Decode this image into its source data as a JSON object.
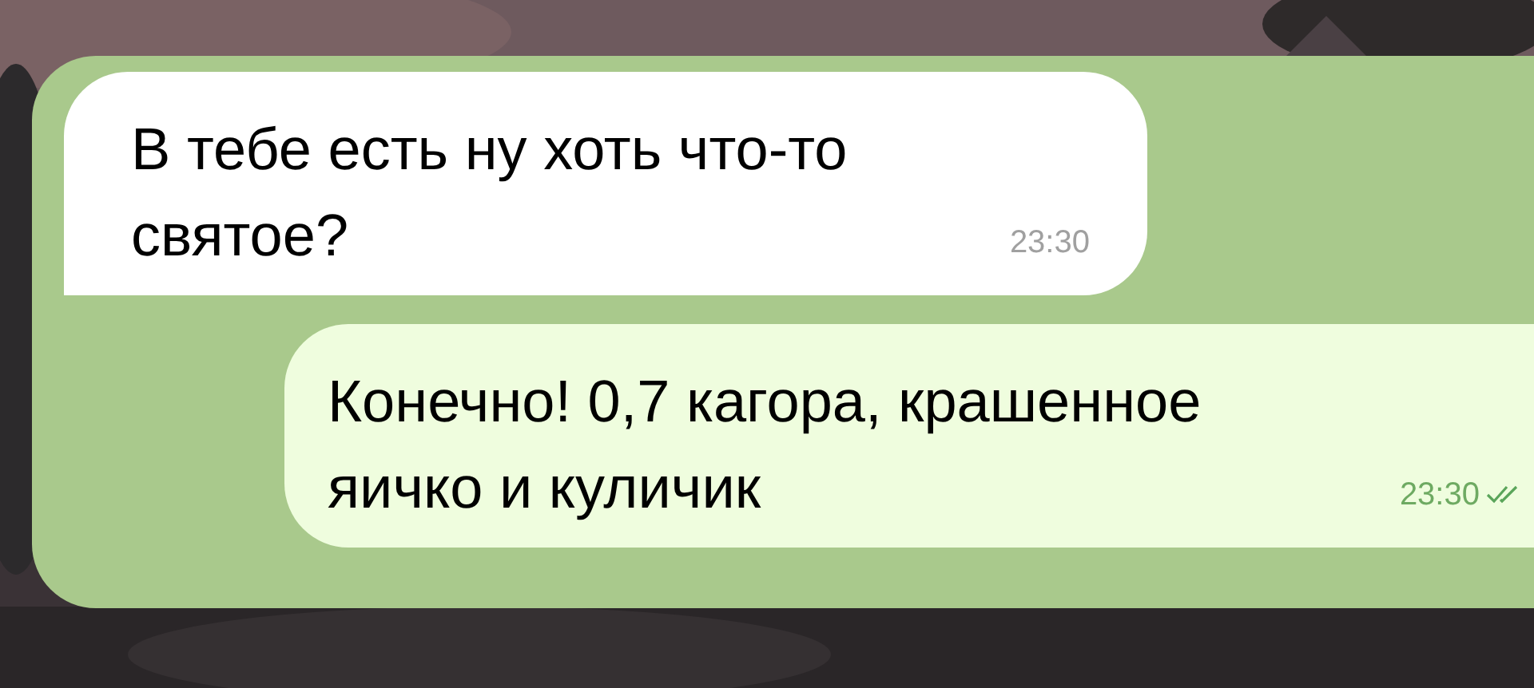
{
  "messages": [
    {
      "kind": "incoming",
      "text": "В тебе есть ну хоть что-то святое?",
      "time": "23:30"
    },
    {
      "kind": "outgoing",
      "text": "Конечно! 0,7 кагора, крашенное яичко и куличик",
      "time": "23:30",
      "read": true
    }
  ]
}
